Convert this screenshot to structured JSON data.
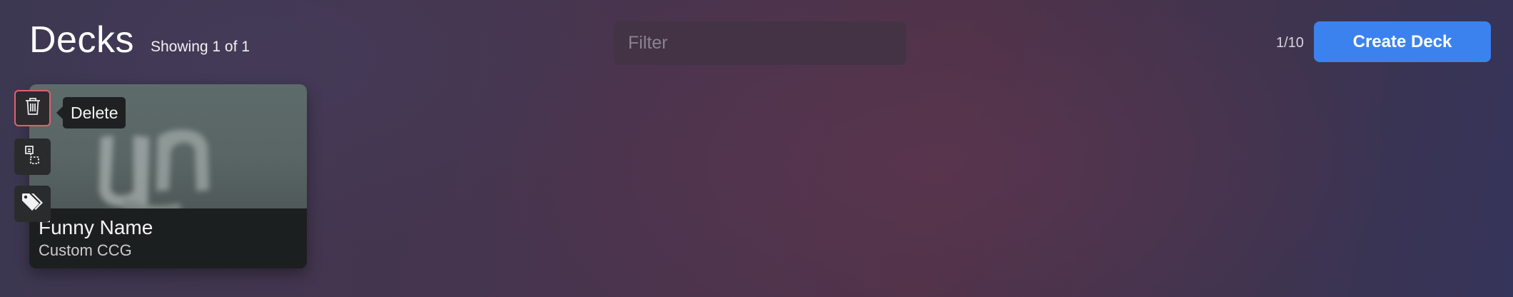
{
  "header": {
    "title": "Decks",
    "showing": "Showing 1 of 1",
    "filter_placeholder": "Filter",
    "filter_value": "",
    "page_count": "1/10",
    "create_label": "Create Deck"
  },
  "deck": {
    "name": "Funny Name",
    "type": "Custom CCG"
  },
  "actions": [
    {
      "icon": "trash-icon",
      "label": "Delete"
    },
    {
      "icon": "duplicate-icon"
    },
    {
      "icon": "tags-icon"
    }
  ],
  "tooltip": {
    "text": "Delete"
  },
  "colors": {
    "accent": "#3c82ee",
    "danger_border": "#e0606f",
    "background_start": "#3b3750",
    "background_mid": "#4d3248"
  }
}
